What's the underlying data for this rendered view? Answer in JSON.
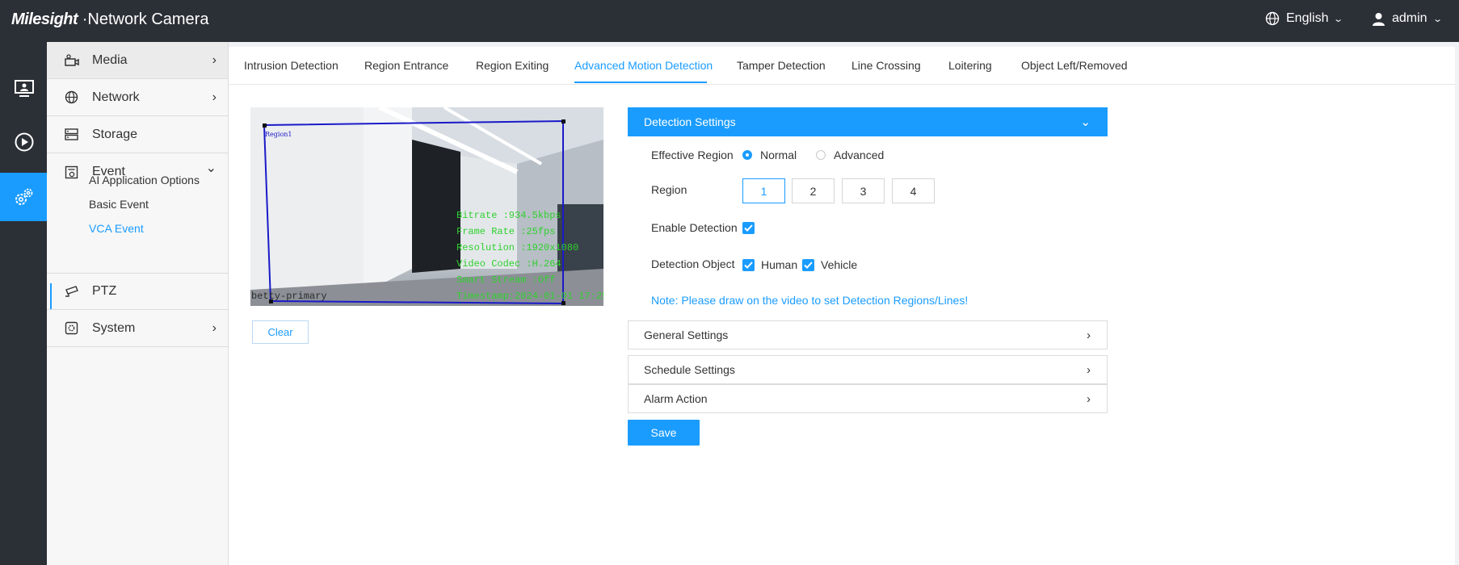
{
  "header": {
    "brand_logo": "Milesight",
    "brand_product": "Network Camera",
    "language": "English",
    "user": "admin"
  },
  "rail": {
    "items": [
      {
        "name": "live-view-icon"
      },
      {
        "name": "playback-icon"
      },
      {
        "name": "settings-icon",
        "active": true
      }
    ]
  },
  "sidebar": {
    "items": [
      {
        "label": "Media",
        "icon": "camera-icon",
        "arrow": "›"
      },
      {
        "label": "Network",
        "icon": "globe-icon",
        "arrow": "›"
      },
      {
        "label": "Storage",
        "icon": "storage-icon",
        "arrow": ""
      },
      {
        "label": "Event",
        "icon": "event-icon",
        "arrow": "⌄"
      },
      {
        "label": "PTZ",
        "icon": "ptz-icon",
        "arrow": ""
      },
      {
        "label": "System",
        "icon": "system-icon",
        "arrow": "›"
      }
    ],
    "event_subitems": [
      {
        "label": "AI Application Options"
      },
      {
        "label": "Basic Event"
      },
      {
        "label": "VCA Event",
        "active": true
      }
    ]
  },
  "tabs": [
    {
      "label": "Intrusion Detection"
    },
    {
      "label": "Region Entrance"
    },
    {
      "label": "Region Exiting"
    },
    {
      "label": "Advanced Motion Detection",
      "active": true
    },
    {
      "label": "Tamper Detection"
    },
    {
      "label": "Line Crossing"
    },
    {
      "label": "Loitering"
    },
    {
      "label": "Object Left/Removed"
    }
  ],
  "video": {
    "region_label": "Region1",
    "stream_label": "betty-primary",
    "overlay_lines": [
      "Bitrate :934.5kbps",
      "Frame Rate :25fps",
      "Resolution :1920x1080",
      "Video Codec :H.264",
      "Smart Stream :Off",
      "Timestamp:2024-01-01 17:25"
    ],
    "clear_label": "Clear"
  },
  "detection": {
    "header": "Detection Settings",
    "effective_region_label": "Effective Region",
    "effective_region_options": [
      "Normal",
      "Advanced"
    ],
    "effective_region_selected": "Normal",
    "region_label": "Region",
    "regions": [
      "1",
      "2",
      "3",
      "4"
    ],
    "region_selected": "1",
    "enable_label": "Enable Detection",
    "enable_checked": true,
    "object_label": "Detection Object",
    "objects": [
      {
        "label": "Human",
        "checked": true
      },
      {
        "label": "Vehicle",
        "checked": true
      }
    ],
    "note": "Note: Please draw on the video to set Detection Regions/Lines!"
  },
  "sections": [
    {
      "label": "General Settings"
    },
    {
      "label": "Schedule Settings"
    },
    {
      "label": "Alarm Action"
    }
  ],
  "save_label": "Save",
  "colors": {
    "accent": "#1a9cff",
    "header_bg": "#2b2f36",
    "region_box": "#1a1ac8",
    "overlay_text": "#2fd12f"
  }
}
